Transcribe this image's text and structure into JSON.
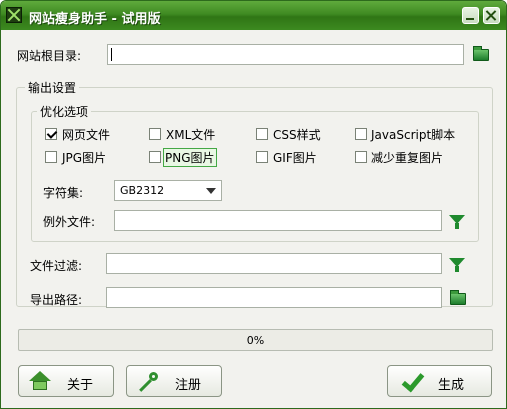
{
  "window": {
    "title": "网站瘦身助手 - 试用版",
    "minimize_icon": "minimize-icon",
    "close_icon": "close-icon",
    "app_icon": "app-logo-icon"
  },
  "root_dir": {
    "label": "网站根目录:",
    "value": "",
    "browse_icon": "folder-icon"
  },
  "output_settings": {
    "title": "输出设置",
    "optimize": {
      "title": "优化选项",
      "options": [
        {
          "label": "网页文件",
          "checked": true
        },
        {
          "label": "XML文件",
          "checked": false
        },
        {
          "label": "CSS样式",
          "checked": false
        },
        {
          "label": "JavaScript脚本",
          "checked": false
        },
        {
          "label": "JPG图片",
          "checked": false
        },
        {
          "label": "PNG图片",
          "checked": false
        },
        {
          "label": "GIF图片",
          "checked": false
        },
        {
          "label": "减少重复图片",
          "checked": false
        }
      ]
    },
    "charset": {
      "label": "字符集:",
      "value": "GB2312"
    },
    "exclude_files": {
      "label": "例外文件:",
      "value": "",
      "filter_icon": "filter-icon"
    }
  },
  "file_filter": {
    "label": "文件过滤:",
    "value": "",
    "filter_icon": "filter-icon"
  },
  "export_path": {
    "label": "导出路径:",
    "value": "",
    "browse_icon": "folder-icon"
  },
  "progress": {
    "value": 0,
    "text": "0%"
  },
  "buttons": {
    "about": {
      "label": "关于",
      "icon": "home-icon"
    },
    "register": {
      "label": "注册",
      "icon": "key-icon"
    },
    "generate": {
      "label": "生成",
      "icon": "checkmark-icon"
    }
  },
  "colors": {
    "titlebar": "#3f8a22",
    "accent": "#1f8a2e"
  }
}
